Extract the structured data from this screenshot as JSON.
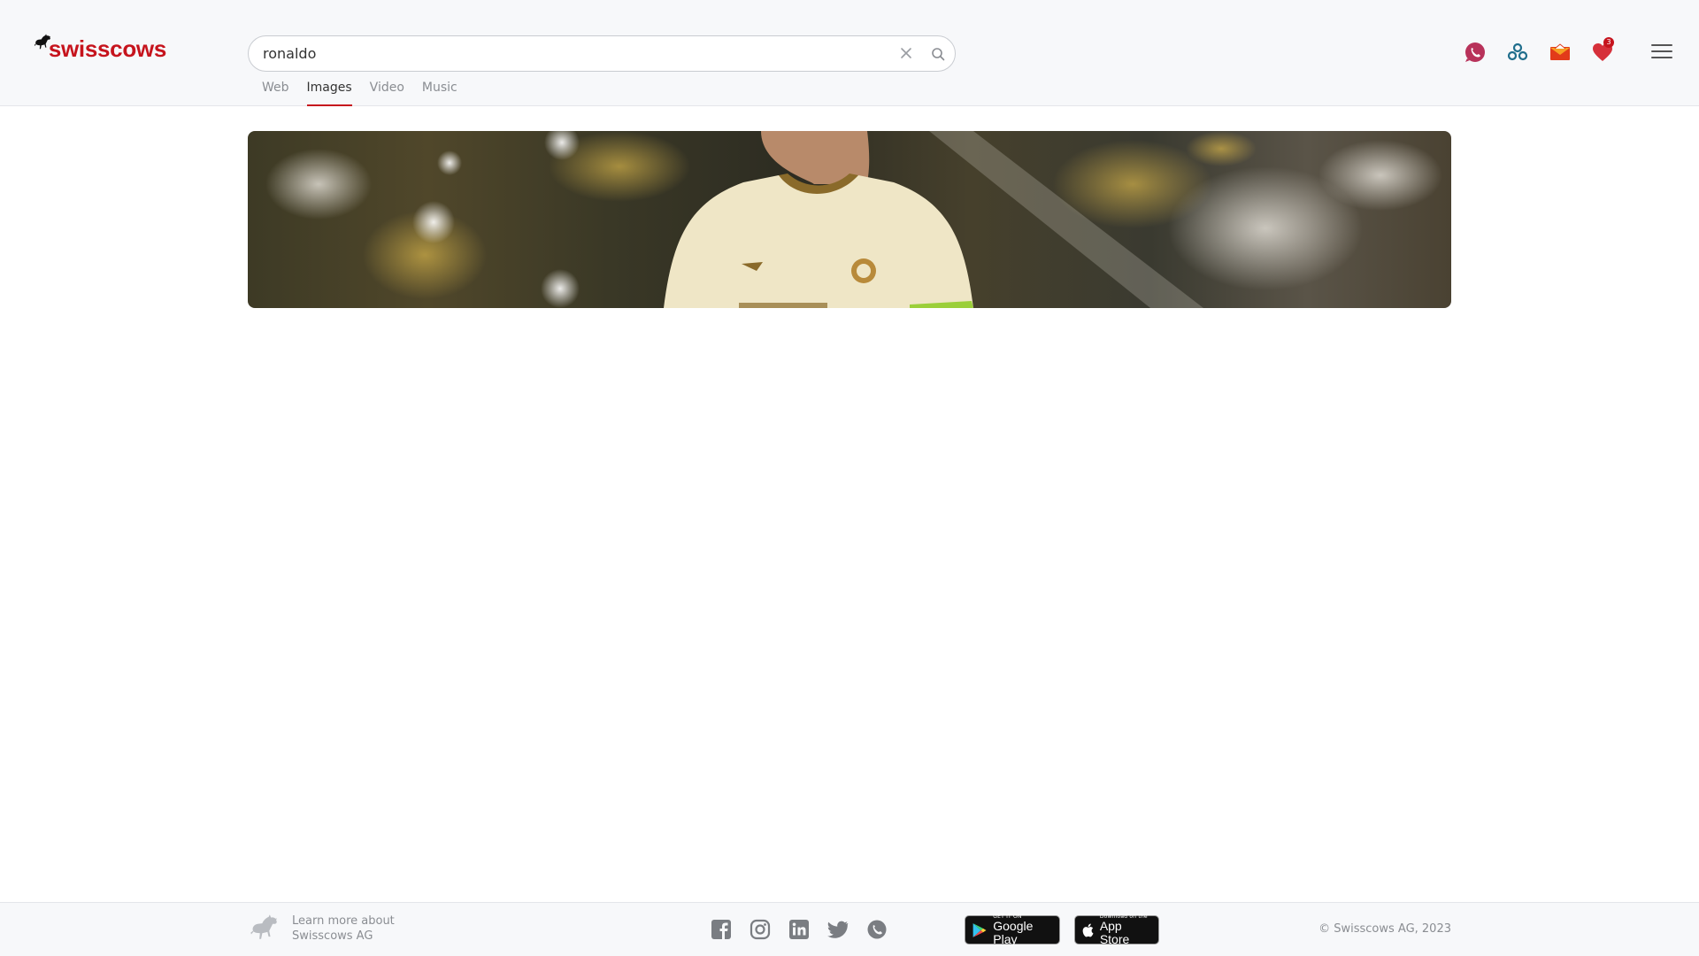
{
  "brand": {
    "name": "swisscows",
    "accent_color": "#c6141d"
  },
  "search": {
    "query": "ronaldo",
    "placeholder": "",
    "clear_icon": "close-icon",
    "submit_icon": "search-icon"
  },
  "tabs": [
    {
      "label": "Web",
      "active": false
    },
    {
      "label": "Images",
      "active": true
    },
    {
      "label": "Video",
      "active": false
    },
    {
      "label": "Music",
      "active": false
    }
  ],
  "header_icons": [
    {
      "name": "teleguard-icon",
      "color": "#b8325a"
    },
    {
      "name": "vpn-icon",
      "color": "#1f6e8c"
    },
    {
      "name": "email-icon",
      "color": "#e23a1a"
    },
    {
      "name": "heart-icon",
      "color": "#d6303a",
      "badge": "3"
    }
  ],
  "results": {
    "images": [
      {
        "description": "Football player in cream-colored jersey"
      }
    ]
  },
  "footer": {
    "learn_line1": "Learn more about",
    "learn_line2": "Swisscows AG",
    "socials": [
      "facebook-icon",
      "instagram-icon",
      "linkedin-icon",
      "twitter-icon",
      "teleguard-icon"
    ],
    "google_play_small": "GET IT ON",
    "google_play_big": "Google Play",
    "app_store_small": "Download on the",
    "app_store_big": "App Store",
    "copyright": "© Swisscows AG, 2023"
  }
}
